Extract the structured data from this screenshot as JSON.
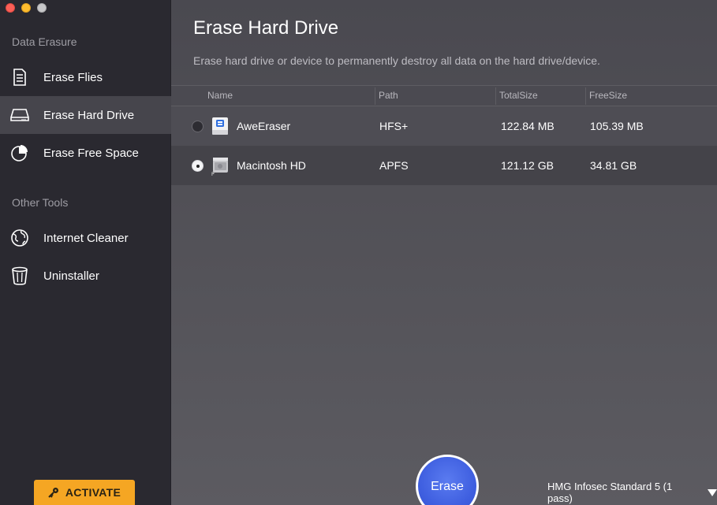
{
  "sidebar": {
    "section_erasure": "Data Erasure",
    "section_tools": "Other Tools",
    "items": [
      {
        "label": "Erase Flies",
        "icon": "document-icon"
      },
      {
        "label": "Erase Hard Drive",
        "icon": "hard-drive-icon"
      },
      {
        "label": "Erase Free Space",
        "icon": "pie-chart-icon"
      },
      {
        "label": "Internet Cleaner",
        "icon": "globe-icon"
      },
      {
        "label": "Uninstaller",
        "icon": "trash-icon"
      }
    ],
    "activate_label": "ACTIVATE"
  },
  "main": {
    "title": "Erase Hard Drive",
    "description": "Erase hard drive or device to permanently destroy all data on the hard drive/device.",
    "columns": [
      "Name",
      "Path",
      "TotalSize",
      "FreeSize"
    ],
    "rows": [
      {
        "name": "AweEraser",
        "path": "HFS+",
        "total": "122.84 MB",
        "free": "105.39 MB",
        "selected": false
      },
      {
        "name": "Macintosh HD",
        "path": "APFS",
        "total": "121.12 GB",
        "free": "34.81 GB",
        "selected": true
      }
    ],
    "erase_label": "Erase",
    "method_label": "HMG Infosec Standard 5 (1 pass)"
  },
  "colors": {
    "accent": "#3f5fe0",
    "activate": "#f5a623",
    "sidebar_bg": "#2a2930",
    "main_bg": "#4a4950"
  }
}
